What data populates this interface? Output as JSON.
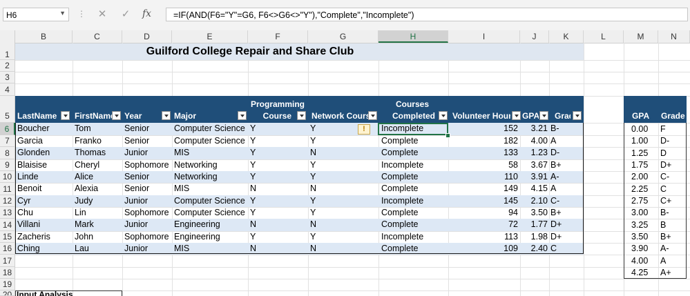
{
  "formula_bar": {
    "name_box": "H6",
    "fx_label": "fx",
    "formula": "=IF(AND(F6=\"Y\"=G6, F6<>G6<>\"Y\"),\"Complete\",\"Incomplete\")"
  },
  "columns": [
    "B",
    "C",
    "D",
    "E",
    "F",
    "G",
    "H",
    "I",
    "J",
    "K",
    "L",
    "M",
    "N"
  ],
  "rows": [
    "1",
    "2",
    "3",
    "4",
    "5",
    "6",
    "7",
    "8",
    "9",
    "10",
    "11",
    "12",
    "13",
    "14",
    "15",
    "16",
    "17",
    "18",
    "19",
    "20"
  ],
  "title": "Guilford College Repair and Share Club",
  "headers": {
    "lastname": "LastName",
    "firstname": "FirstName",
    "year": "Year",
    "major": "Major",
    "programming_line1": "Programming",
    "programming_line2": "Course",
    "network": "Network Course",
    "courses_line1": "Courses",
    "courses_line2": "Completed",
    "volunteer": "Volunteer Hours",
    "gpa": "GPA",
    "grade": "Grade"
  },
  "table_rows": [
    {
      "last": "Boucher",
      "first": "Tom",
      "year": "Senior",
      "major": "Computer Science",
      "prog": "Y",
      "net": "Y",
      "completed": "Incomplete",
      "hours": "152",
      "gpa": "3.21",
      "grade": "B-"
    },
    {
      "last": "Garcia",
      "first": "Franko",
      "year": "Senior",
      "major": "Computer Science",
      "prog": "Y",
      "net": "Y",
      "completed": "Complete",
      "hours": "182",
      "gpa": "4.00",
      "grade": "A"
    },
    {
      "last": "Glonden",
      "first": "Thomas",
      "year": "Junior",
      "major": "MIS",
      "prog": "Y",
      "net": "N",
      "completed": "Complete",
      "hours": "133",
      "gpa": "1.23",
      "grade": "D-"
    },
    {
      "last": "Blaisise",
      "first": "Cheryl",
      "year": "Sophomore",
      "major": "Networking",
      "prog": "Y",
      "net": "Y",
      "completed": "Incomplete",
      "hours": "58",
      "gpa": "3.67",
      "grade": "B+"
    },
    {
      "last": "Linde",
      "first": "Alice",
      "year": "Senior",
      "major": "Networking",
      "prog": "Y",
      "net": "Y",
      "completed": "Complete",
      "hours": "110",
      "gpa": "3.91",
      "grade": "A-"
    },
    {
      "last": "Benoit",
      "first": "Alexia",
      "year": "Senior",
      "major": "MIS",
      "prog": "N",
      "net": "N",
      "completed": "Complete",
      "hours": "149",
      "gpa": "4.15",
      "grade": "A"
    },
    {
      "last": "Cyr",
      "first": "Judy",
      "year": "Junior",
      "major": "Computer Science",
      "prog": "Y",
      "net": "Y",
      "completed": "Incomplete",
      "hours": "145",
      "gpa": "2.10",
      "grade": "C-"
    },
    {
      "last": "Chu",
      "first": "Lin",
      "year": "Sophomore",
      "major": "Computer Science",
      "prog": "Y",
      "net": "Y",
      "completed": "Complete",
      "hours": "94",
      "gpa": "3.50",
      "grade": "B+"
    },
    {
      "last": "Villani",
      "first": "Mark",
      "year": "Junior",
      "major": "Engineering",
      "prog": "N",
      "net": "N",
      "completed": "Complete",
      "hours": "72",
      "gpa": "1.77",
      "grade": "D+"
    },
    {
      "last": "Zacheris",
      "first": "John",
      "year": "Sophomore",
      "major": "Engineering",
      "prog": "Y",
      "net": "Y",
      "completed": "Incomplete",
      "hours": "113",
      "gpa": "1.98",
      "grade": "D+"
    },
    {
      "last": "Ching",
      "first": "Lau",
      "year": "Junior",
      "major": "MIS",
      "prog": "N",
      "net": "N",
      "completed": "Complete",
      "hours": "109",
      "gpa": "2.40",
      "grade": "C"
    }
  ],
  "lookup": {
    "gpa_header": "GPA",
    "grade_header": "Grade",
    "rows": [
      {
        "gpa": "0.00",
        "grade": "F"
      },
      {
        "gpa": "1.00",
        "grade": "D-"
      },
      {
        "gpa": "1.25",
        "grade": "D"
      },
      {
        "gpa": "1.75",
        "grade": "D+"
      },
      {
        "gpa": "2.00",
        "grade": "C-"
      },
      {
        "gpa": "2.25",
        "grade": "C"
      },
      {
        "gpa": "2.75",
        "grade": "C+"
      },
      {
        "gpa": "3.00",
        "grade": "B-"
      },
      {
        "gpa": "3.25",
        "grade": "B"
      },
      {
        "gpa": "3.50",
        "grade": "B+"
      },
      {
        "gpa": "3.90",
        "grade": "A-"
      },
      {
        "gpa": "4.00",
        "grade": "A"
      },
      {
        "gpa": "4.25",
        "grade": "A+"
      }
    ]
  },
  "bottom_text": "Input Analysis",
  "colors": {
    "header_fill": "#1f4e79",
    "band_fill": "#dde8f5",
    "title_fill": "#dfe7f1",
    "select_green": "#217346"
  }
}
